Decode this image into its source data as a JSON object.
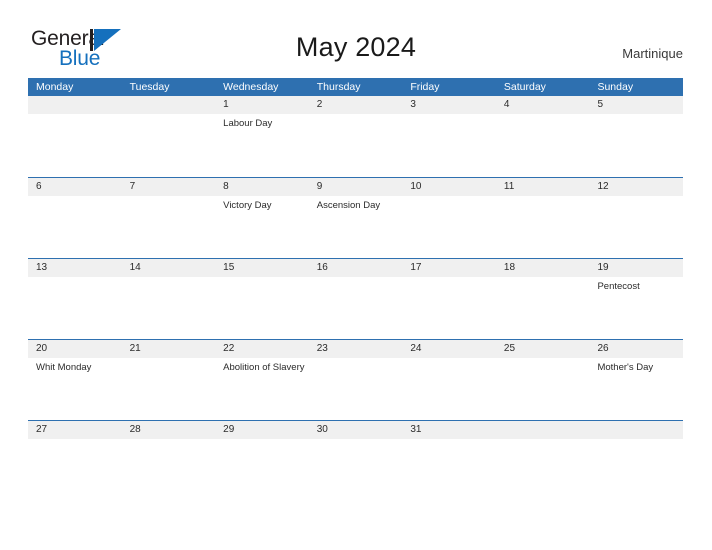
{
  "brand": {
    "name_part1": "General",
    "name_part2": "Blue",
    "mark": "triangle-flag",
    "color_text": "#231f20",
    "color_accent": "#1570bd"
  },
  "header": {
    "title": "May 2024",
    "region": "Martinique"
  },
  "theme": {
    "header_blue": "#2e70b0",
    "band_gray": "#f0f0f0",
    "text": "#2b2b2b",
    "page_background": "#ffffff"
  },
  "calendar": {
    "month": "May",
    "year": "2024",
    "weekday_headers": [
      "Monday",
      "Tuesday",
      "Wednesday",
      "Thursday",
      "Friday",
      "Saturday",
      "Sunday"
    ],
    "weeks": [
      {
        "days": [
          {
            "num": "",
            "events": []
          },
          {
            "num": "",
            "events": []
          },
          {
            "num": "1",
            "events": [
              "Labour Day"
            ]
          },
          {
            "num": "2",
            "events": []
          },
          {
            "num": "3",
            "events": []
          },
          {
            "num": "4",
            "events": []
          },
          {
            "num": "5",
            "events": []
          }
        ]
      },
      {
        "days": [
          {
            "num": "6",
            "events": []
          },
          {
            "num": "7",
            "events": []
          },
          {
            "num": "8",
            "events": [
              "Victory Day"
            ]
          },
          {
            "num": "9",
            "events": [
              "Ascension Day"
            ]
          },
          {
            "num": "10",
            "events": []
          },
          {
            "num": "11",
            "events": []
          },
          {
            "num": "12",
            "events": []
          }
        ]
      },
      {
        "days": [
          {
            "num": "13",
            "events": []
          },
          {
            "num": "14",
            "events": []
          },
          {
            "num": "15",
            "events": []
          },
          {
            "num": "16",
            "events": []
          },
          {
            "num": "17",
            "events": []
          },
          {
            "num": "18",
            "events": []
          },
          {
            "num": "19",
            "events": [
              "Pentecost"
            ]
          }
        ]
      },
      {
        "days": [
          {
            "num": "20",
            "events": [
              "Whit Monday"
            ]
          },
          {
            "num": "21",
            "events": []
          },
          {
            "num": "22",
            "events": [
              "Abolition of Slavery"
            ]
          },
          {
            "num": "23",
            "events": []
          },
          {
            "num": "24",
            "events": []
          },
          {
            "num": "25",
            "events": []
          },
          {
            "num": "26",
            "events": [
              "Mother's Day"
            ]
          }
        ]
      },
      {
        "days": [
          {
            "num": "27",
            "events": []
          },
          {
            "num": "28",
            "events": []
          },
          {
            "num": "29",
            "events": []
          },
          {
            "num": "30",
            "events": []
          },
          {
            "num": "31",
            "events": []
          },
          {
            "num": "",
            "events": []
          },
          {
            "num": "",
            "events": []
          }
        ]
      }
    ]
  }
}
